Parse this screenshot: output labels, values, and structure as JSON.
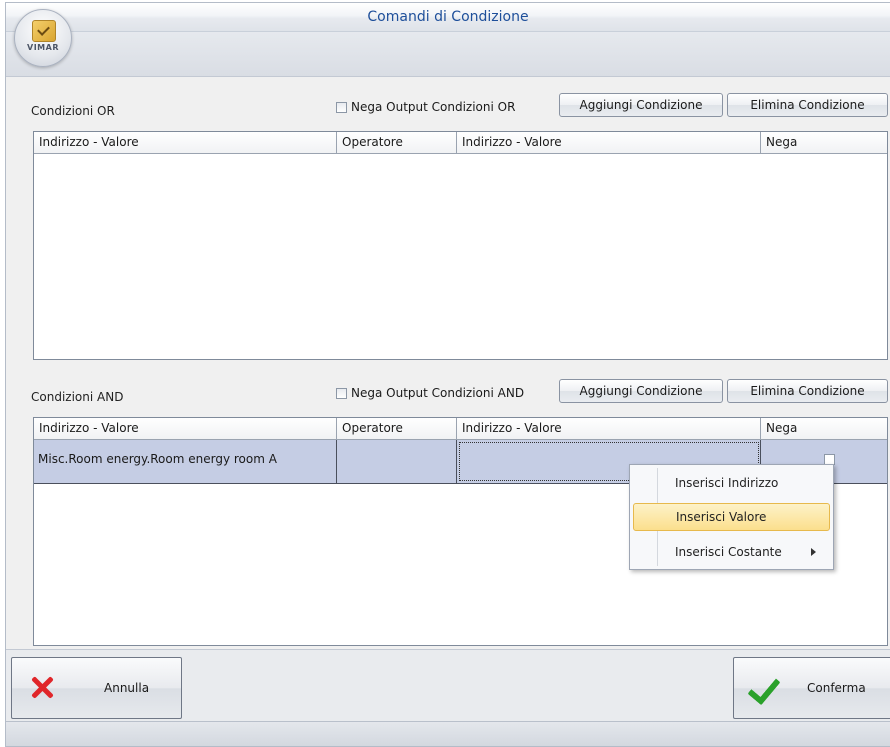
{
  "window": {
    "title": "Comandi di Condizione"
  },
  "logo": {
    "text": "VIMAR"
  },
  "or_section": {
    "label": "Condizioni OR",
    "negate_label": "Nega Output Condizioni OR",
    "negate_checked": false,
    "add_button": "Aggiungi Condizione",
    "delete_button": "Elimina Condizione",
    "columns": [
      "Indirizzo - Valore",
      "Operatore",
      "Indirizzo - Valore",
      "Nega"
    ],
    "rows": []
  },
  "and_section": {
    "label": "Condizioni AND",
    "negate_label": "Nega Output Condizioni AND",
    "negate_checked": false,
    "add_button": "Aggiungi Condizione",
    "delete_button": "Elimina Condizione",
    "columns": [
      "Indirizzo - Valore",
      "Operatore",
      "Indirizzo - Valore",
      "Nega"
    ],
    "rows": [
      {
        "address_value_1": "Misc.Room energy.Room energy room A",
        "operator": "",
        "address_value_2": "",
        "negate": false
      }
    ]
  },
  "context_menu": {
    "items": [
      {
        "label": "Inserisci Indirizzo"
      },
      {
        "label": "Inserisci Valore",
        "highlighted": true
      },
      {
        "label": "Inserisci Costante",
        "has_submenu": true
      }
    ]
  },
  "footer": {
    "cancel_label": "Annulla",
    "confirm_label": "Conferma"
  },
  "colors": {
    "title": "#1e4f9a",
    "selected_row": "#c5cde4",
    "menu_highlight": "#fbdf8d",
    "cancel_icon": "#e0262a",
    "confirm_icon": "#2aa12b"
  }
}
